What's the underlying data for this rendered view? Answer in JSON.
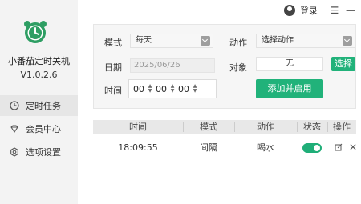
{
  "app": {
    "name": "小番茄定时关机",
    "version": "V1.0.2.6"
  },
  "topbar": {
    "login_label": "登录",
    "menu_glyph": "☰",
    "minimize_glyph": "—"
  },
  "sidebar": {
    "items": [
      {
        "label": "定时任务",
        "icon": "clock-icon",
        "active": true
      },
      {
        "label": "会员中心",
        "icon": "diamond-icon",
        "active": false
      },
      {
        "label": "选项设置",
        "icon": "gear-icon",
        "active": false
      }
    ]
  },
  "form": {
    "mode_label": "模式",
    "mode_value": "每天",
    "action_label": "动作",
    "action_value": "选择动作",
    "date_label": "日期",
    "date_value": "2025/06/26",
    "target_label": "对象",
    "target_value": "无",
    "select_button": "选择",
    "time_label": "时间",
    "time_hh": "00",
    "time_mm": "00",
    "time_ss": "00",
    "add_button": "添加并启用"
  },
  "table": {
    "headers": [
      "时间",
      "模式",
      "动作",
      "状态",
      "操作"
    ],
    "rows": [
      {
        "time": "18:09:55",
        "mode": "间隔",
        "action": "喝水",
        "enabled": true
      }
    ]
  },
  "colors": {
    "accent": "#21b27a",
    "logo": "#2e9e63"
  }
}
